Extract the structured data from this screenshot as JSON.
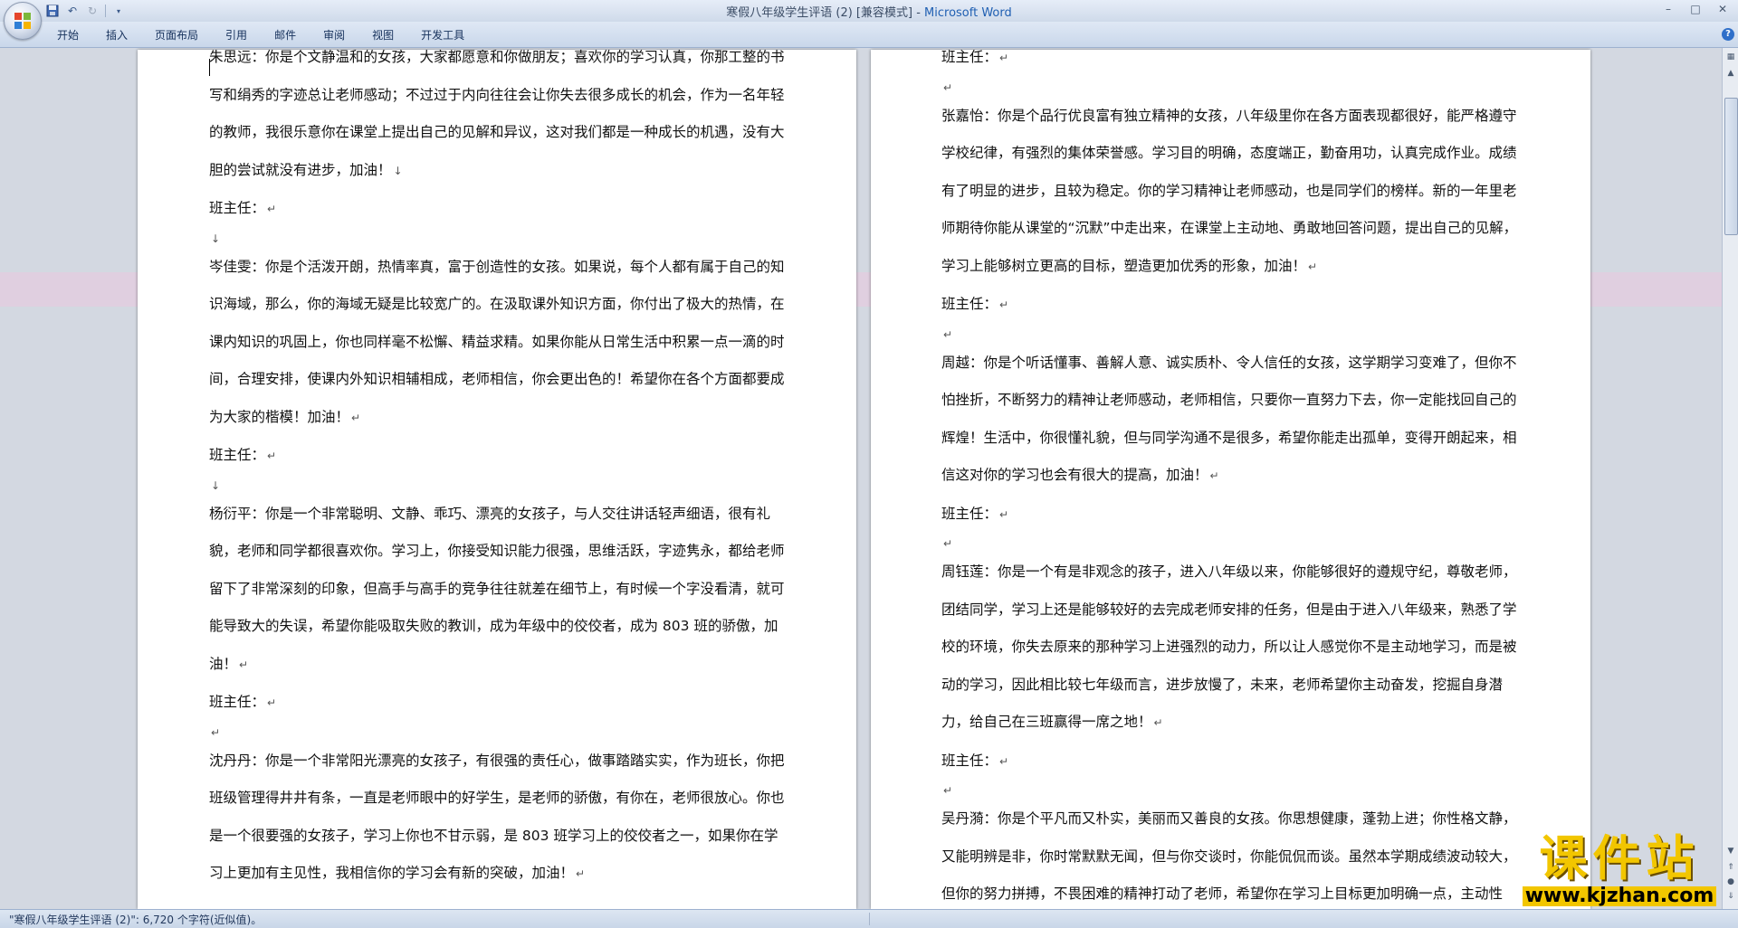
{
  "window": {
    "title": "寒假八年级学生评语 (2) [兼容模式] - ",
    "app_name": "Microsoft Word",
    "controls": {
      "minimize": "–",
      "maximize": "□",
      "close": "✕"
    }
  },
  "ribbon": {
    "tabs": [
      "开始",
      "插入",
      "页面布局",
      "引用",
      "邮件",
      "审阅",
      "视图",
      "开发工具"
    ]
  },
  "document": {
    "left_page": [
      "朱思远：你是个文静温和的女孩，大家都愿意和你做朋友；喜欢你的学习认真，你那工整的书写和绢秀的字迹总让老师感动；不过过于内向往往会让你失去很多成长的机会，作为一名年轻的教师，我很乐意你在课堂上提出自己的见解和异议，这对我们都是一种成长的机遇，没有大胆的尝试就没有进步，加油！",
      "班主任：",
      "",
      "岑佳雯：你是个活泼开朗，热情率真，富于创造性的女孩。如果说，每个人都有属于自己的知识海域，那么，你的海域无疑是比较宽广的。在汲取课外知识方面，你付出了极大的热情，在课内知识的巩固上，你也同样毫不松懈、精益求精。如果你能从日常生活中积累一点一滴的时间，合理安排，使课内外知识相辅相成，老师相信，你会更出色的！希望你在各个方面都要成为大家的楷模！加油！",
      "班主任：",
      "",
      "杨衍平：你是一个非常聪明、文静、乖巧、漂亮的女孩子，与人交往讲话轻声细语，很有礼貌，老师和同学都很喜欢你。学习上，你接受知识能力很强，思维活跃，字迹隽永，都给老师留下了非常深刻的印象，但高手与高手的竞争往往就差在细节上，有时候一个字没看清，就可能导致大的失误，希望你能吸取失败的教训，成为年级中的佼佼者，成为 803 班的骄傲，加油！",
      "班主任：",
      "",
      "沈丹丹：你是一个非常阳光漂亮的女孩子，有很强的责任心，做事踏踏实实，作为班长，你把班级管理得井井有条，一直是老师眼中的好学生，是老师的骄傲，有你在，老师很放心。你也是一个很要强的女孩子，学习上你也不甘示弱，是 803 班学习上的佼佼者之一，如果你在学习上更加有主见性，我相信你的学习会有新的突破，加油！"
    ],
    "right_page": [
      "班主任：",
      "",
      "张嘉怡：你是个品行优良富有独立精神的女孩，八年级里你在各方面表现都很好，能严格遵守学校纪律，有强烈的集体荣誉感。学习目的明确，态度端正，勤奋用功，认真完成作业。成绩有了明显的进步，且较为稳定。你的学习精神让老师感动，也是同学们的榜样。新的一年里老师期待你能从课堂的“沉默”中走出来，在课堂上主动地、勇敢地回答问题，提出自己的见解，学习上能够树立更高的目标，塑造更加优秀的形象，加油！",
      "班主任：",
      "",
      "周越：你是个听话懂事、善解人意、诚实质朴、令人信任的女孩，这学期学习变难了，但你不怕挫折，不断努力的精神让老师感动，老师相信，只要你一直努力下去，你一定能找回自己的辉煌！生活中，你很懂礼貌，但与同学沟通不是很多，希望你能走出孤单，变得开朗起来，相信这对你的学习也会有很大的提高，加油！",
      "班主任：",
      "",
      "周钰莲：你是一个有是非观念的孩子，进入八年级以来，你能够很好的遵规守纪，尊敬老师，团结同学，学习上还是能够较好的去完成老师安排的任务，但是由于进入八年级来，熟悉了学校的环境，你失去原来的那种学习上进强烈的动力，所以让人感觉你不是主动地学习，而是被动的学习，因此相比较七年级而言，进步放慢了，未来，老师希望你主动奋发，挖掘自身潜力，给自己在三班赢得一席之地！",
      "班主任：",
      "",
      "吴丹漪：你是个平凡而又朴实，美丽而又善良的女孩。你思想健康，蓬勃上进；你性格文静，又能明辨是非，你时常默默无闻，但与你交谈时，你能侃侃而谈。虽然本学期成绩波动较大，但你的努力拼搏，不畏困难的精神打动了老师，希望你在学习上目标更加明确一点，主动性"
    ]
  },
  "status_bar": {
    "text": "\"寒假八年级学生评语 (2)\": 6,720 个字符(近似值)。"
  },
  "watermark": {
    "line1": "课件站",
    "line2": "www.kjzhan.com"
  }
}
